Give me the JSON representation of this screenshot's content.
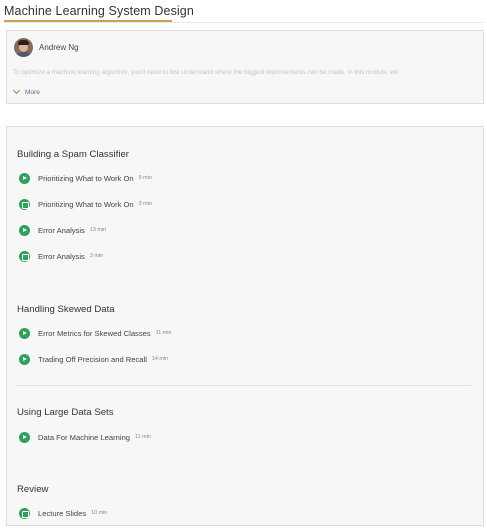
{
  "page": {
    "title": "Machine Learning System Design"
  },
  "instructor": {
    "name": "Andrew Ng",
    "description": "To optimize a machine learning algorithm, you'll need to first understand where the biggest improvements can be made. In this module, we",
    "more_label": "More"
  },
  "sections": [
    {
      "title": "Building a Spam Classifier",
      "items": [
        {
          "label": "Prioritizing What to Work On",
          "duration": "9 min",
          "icon": "play-icon"
        },
        {
          "label": "Prioritizing What to Work On",
          "duration": "3 min",
          "icon": "reading-icon"
        },
        {
          "label": "Error Analysis",
          "duration": "13 min",
          "icon": "play-icon"
        },
        {
          "label": "Error Analysis",
          "duration": "3 min",
          "icon": "reading-icon"
        }
      ]
    },
    {
      "title": "Handling Skewed Data",
      "items": [
        {
          "label": "Error Metrics for Skewed Classes",
          "duration": "11 min",
          "icon": "play-icon"
        },
        {
          "label": "Trading Off Precision and Recall",
          "duration": "14 min",
          "icon": "play-icon"
        }
      ]
    },
    {
      "title": "Using Large Data Sets",
      "items": [
        {
          "label": "Data For Machine Learning",
          "duration": "11 min",
          "icon": "play-icon"
        }
      ]
    },
    {
      "title": "Review",
      "items": [
        {
          "label": "Lecture Slides",
          "duration": "10 min",
          "icon": "reading-icon"
        }
      ]
    }
  ],
  "colors": {
    "accent_underline": "#c8a34e",
    "item_icon": "#2ea05c",
    "card_background": "#f7f7f7"
  }
}
